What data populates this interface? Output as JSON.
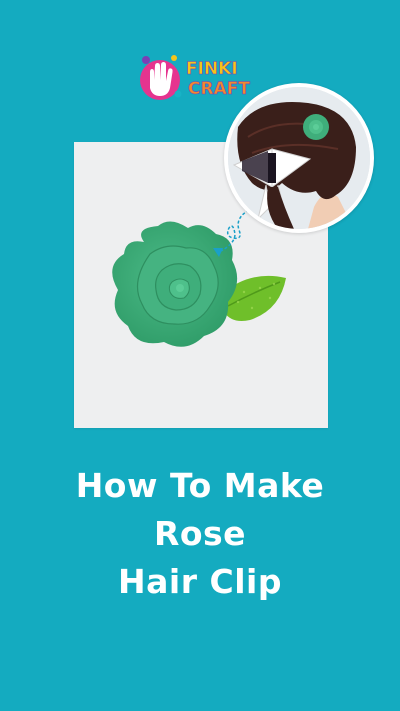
{
  "logo": {
    "line1": "FINKI",
    "line2": "CRAFT",
    "icon": "hand-icon"
  },
  "photo": {
    "subject": "rose-hair-clip-icon"
  },
  "inset": {
    "subject": "hair-model-icon"
  },
  "arrow": {
    "icon": "curly-arrow-icon"
  },
  "title": {
    "line1": "How To Make",
    "line2": "Rose",
    "line3": "Hair Clip"
  },
  "colors": {
    "background": "#14abc0",
    "title_text": "#ffffff",
    "rose_green": "#3fae7b",
    "glitter_green": "#6fbf2a",
    "logo_pink": "#e5348f",
    "logo_purple": "#7b3fb5",
    "logo_yellow": "#f4c51a",
    "logo_orange": "#f08a2e",
    "arrow_blue": "#1aa0c8"
  }
}
